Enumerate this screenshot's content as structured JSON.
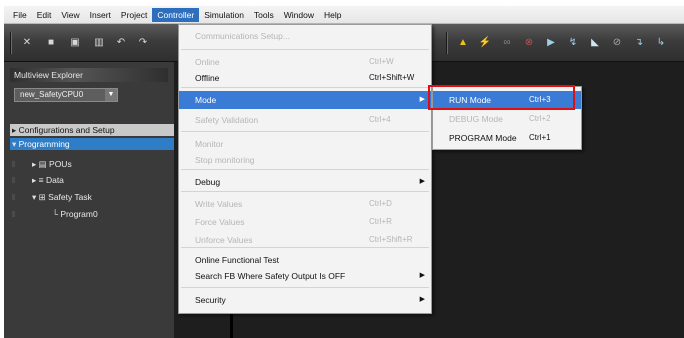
{
  "menubar": {
    "items": [
      "File",
      "Edit",
      "View",
      "Insert",
      "Project",
      "Controller",
      "Simulation",
      "Tools",
      "Window",
      "Help"
    ],
    "active": "Controller"
  },
  "toolbar": {
    "icons": [
      "cut-icon",
      "copy-icon",
      "paste-icon",
      "delete-icon",
      "undo-icon",
      "redo-icon",
      "warning-icon",
      "lightning-icon",
      "transfer-icon",
      "online-icon",
      "program-mode-icon"
    ]
  },
  "explorer": {
    "title": "Multiview Explorer",
    "device": "new_SafetyCPU0",
    "tree": [
      {
        "label": "Configurations and Setup",
        "prefix": "▸",
        "style": "hdr"
      },
      {
        "label": "Programming",
        "prefix": "▾",
        "style": "sel"
      },
      {
        "label": "POUs",
        "prefix": "▸ ▤",
        "style": "normal"
      },
      {
        "label": "Data",
        "prefix": "▸ ≡",
        "style": "normal"
      },
      {
        "label": "Safety Task",
        "prefix": "▾ ⊞",
        "style": "normal"
      },
      {
        "label": "Program0",
        "prefix": "└",
        "style": "normal"
      }
    ]
  },
  "controller_menu": {
    "items": [
      {
        "label": "Communications Setup...",
        "shortcut": "",
        "disabled": true
      },
      {
        "label": "Online",
        "shortcut": "Ctrl+W",
        "disabled": true
      },
      {
        "label": "Offline",
        "shortcut": "Ctrl+Shift+W",
        "disabled": false
      },
      {
        "label": "Mode",
        "shortcut": "",
        "disabled": false,
        "highlighted": true,
        "submenu": true
      },
      {
        "label": "Safety Validation",
        "shortcut": "Ctrl+4",
        "disabled": true
      },
      {
        "label": "Monitor",
        "shortcut": "",
        "disabled": true
      },
      {
        "label": "Stop monitoring",
        "shortcut": "",
        "disabled": true
      },
      {
        "label": "Debug",
        "shortcut": "",
        "disabled": false,
        "submenu": true
      },
      {
        "label": "Write Values",
        "shortcut": "Ctrl+D",
        "disabled": true
      },
      {
        "label": "Force Values",
        "shortcut": "Ctrl+R",
        "disabled": true
      },
      {
        "label": "Unforce Values",
        "shortcut": "Ctrl+Shift+R",
        "disabled": true
      },
      {
        "label": "Online Functional Test",
        "shortcut": "",
        "disabled": false
      },
      {
        "label": "Search FB Where Safety Output Is OFF",
        "shortcut": "",
        "disabled": false,
        "submenu": true
      },
      {
        "label": "Security",
        "shortcut": "",
        "disabled": false,
        "submenu": true
      }
    ]
  },
  "mode_submenu": {
    "items": [
      {
        "label": "RUN Mode",
        "shortcut": "Ctrl+3",
        "disabled": false,
        "highlighted": true
      },
      {
        "label": "DEBUG Mode",
        "shortcut": "Ctrl+2",
        "disabled": true
      },
      {
        "label": "PROGRAM Mode",
        "shortcut": "Ctrl+1",
        "disabled": false
      }
    ]
  },
  "colors": {
    "highlight": "#3a7bd5",
    "callout": "#e01010"
  }
}
